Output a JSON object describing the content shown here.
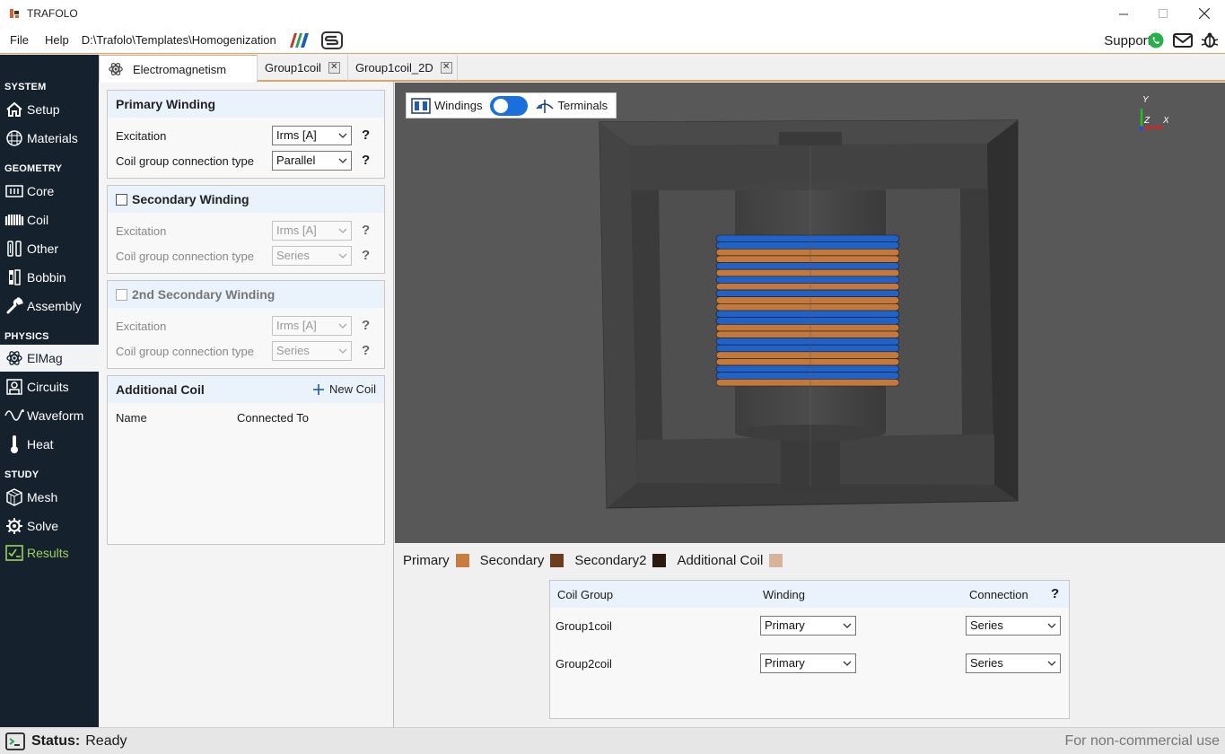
{
  "window": {
    "title": "TRAFOLO",
    "controls": [
      "minimize",
      "maximize",
      "close"
    ]
  },
  "menubar": {
    "items": [
      "File",
      "Help"
    ],
    "path": "D:\\Trafolo\\Templates\\Homogenization",
    "support_label": "Support:",
    "support_icons": [
      "whatsapp-icon",
      "mail-icon",
      "bug-icon"
    ]
  },
  "sidebar": {
    "sections": {
      "system": "SYSTEM",
      "geometry": "GEOMETRY",
      "physics": "PHYSICS",
      "study": "STUDY"
    },
    "items": {
      "setup": "Setup",
      "materials": "Materials",
      "core": "Core",
      "coil": "Coil",
      "other": "Other",
      "bobbin": "Bobbin",
      "assembly": "Assembly",
      "elmag": "ElMag",
      "circuits": "Circuits",
      "waveform": "Waveform",
      "heat": "Heat",
      "mesh": "Mesh",
      "solve": "Solve",
      "results": "Results"
    },
    "active": "ElMag"
  },
  "tabs": [
    {
      "label": "Electromagnetism",
      "active": true
    },
    {
      "label": "Group1coil",
      "active": false
    },
    {
      "label": "Group1coil_2D",
      "active": false
    }
  ],
  "primary": {
    "title": "Primary Winding",
    "excitation_label": "Excitation",
    "excitation_value": "Irms [A]",
    "connection_label": "Coil group connection type",
    "connection_value": "Parallel",
    "help": "?"
  },
  "secondary": {
    "title": "Secondary Winding",
    "checked": false,
    "excitation_label": "Excitation",
    "excitation_value": "Irms [A]",
    "connection_label": "Coil group connection type",
    "connection_value": "Series",
    "help": "?"
  },
  "secondary2": {
    "title": "2nd Secondary Winding",
    "checked": false,
    "excitation_label": "Excitation",
    "excitation_value": "Irms [A]",
    "connection_label": "Coil group connection type",
    "connection_value": "Series",
    "help": "?"
  },
  "additional": {
    "title": "Additional Coil",
    "new_coil": "New Coil",
    "col_name": "Name",
    "col_connected": "Connected To"
  },
  "viewport": {
    "windings_label": "Windings",
    "terminals_label": "Terminals",
    "toggle_on": true,
    "axes": {
      "y": "Y",
      "z": "Z",
      "x": "X"
    }
  },
  "legend": [
    {
      "label": "Primary",
      "color": "#c67d3e"
    },
    {
      "label": "Secondary",
      "color": "#6b3d1c"
    },
    {
      "label": "Secondary2",
      "color": "#2b1a10"
    },
    {
      "label": "Additional Coil",
      "color": "#d6b39a"
    }
  ],
  "coil_group_table": {
    "headers": {
      "group": "Coil Group",
      "winding": "Winding",
      "connection": "Connection",
      "help": "?"
    },
    "rows": [
      {
        "group": "Group1coil",
        "winding": "Primary",
        "connection": "Series"
      },
      {
        "group": "Group2coil",
        "winding": "Primary",
        "connection": "Series"
      }
    ]
  },
  "status": {
    "label": "Status:",
    "value": "Ready",
    "license": "For non-commercial use"
  }
}
